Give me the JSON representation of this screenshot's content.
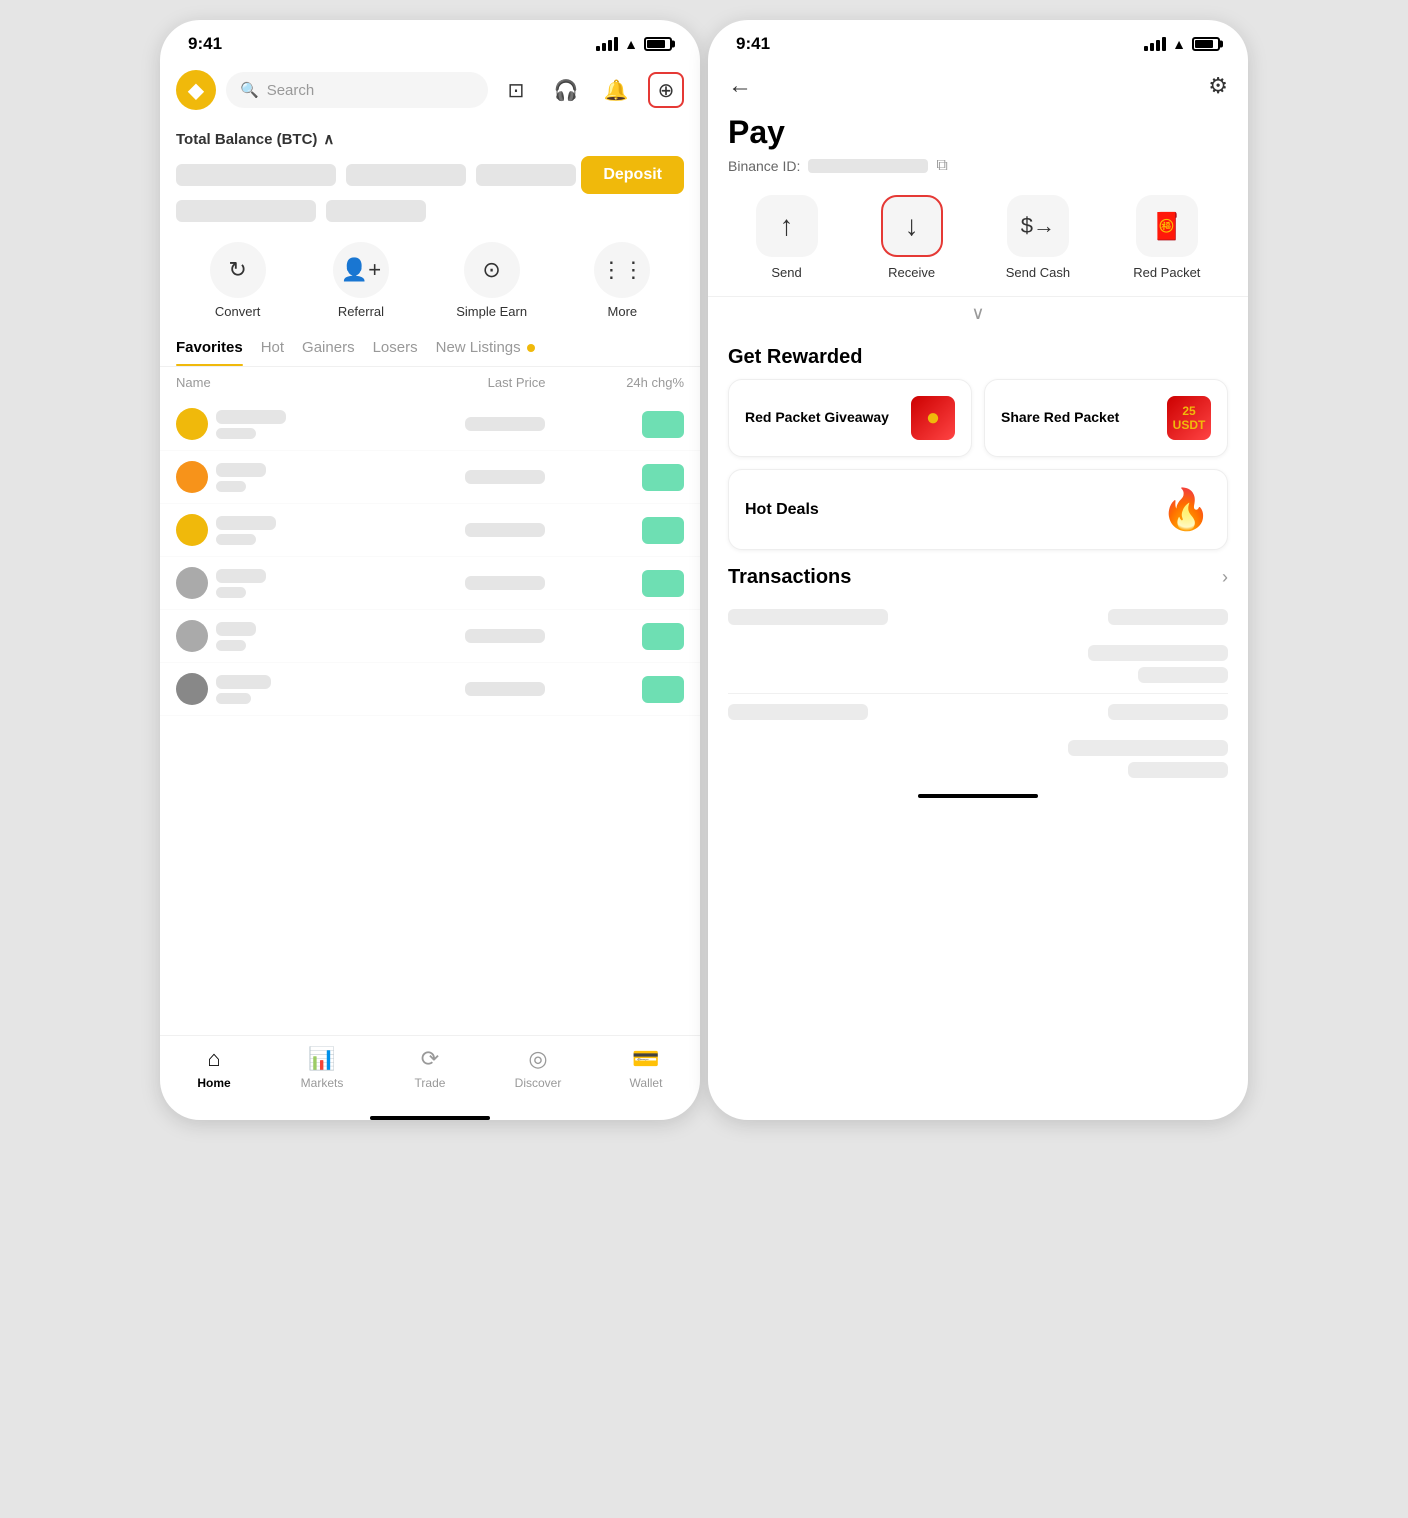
{
  "left_phone": {
    "status": {
      "time": "9:41"
    },
    "header": {
      "search_placeholder": "Search"
    },
    "balance": {
      "title": "Total Balance (BTC)",
      "deposit_label": "Deposit"
    },
    "quick_actions": [
      {
        "id": "convert",
        "label": "Convert",
        "icon": "↻"
      },
      {
        "id": "referral",
        "label": "Referral",
        "icon": "👤"
      },
      {
        "id": "simple-earn",
        "label": "Simple Earn",
        "icon": "⊙"
      },
      {
        "id": "more",
        "label": "More",
        "icon": "⋮⋮"
      }
    ],
    "tabs": [
      {
        "id": "favorites",
        "label": "Favorites",
        "active": true
      },
      {
        "id": "hot",
        "label": "Hot",
        "active": false
      },
      {
        "id": "gainers",
        "label": "Gainers",
        "active": false
      },
      {
        "id": "losers",
        "label": "Losers",
        "active": false
      },
      {
        "id": "new-listings",
        "label": "New Listings",
        "active": false
      }
    ],
    "table": {
      "columns": {
        "name": "Name",
        "price": "Last Price",
        "change": "24h chg%"
      },
      "rows": [
        {
          "id": 1,
          "color": "#F0B90B"
        },
        {
          "id": 2,
          "color": "#F7931A"
        },
        {
          "id": 3,
          "color": "#F0B90B"
        },
        {
          "id": 4,
          "color": "#888"
        },
        {
          "id": 5,
          "color": "#888"
        },
        {
          "id": 6,
          "color": "#888"
        }
      ]
    },
    "bottom_nav": [
      {
        "id": "home",
        "label": "Home",
        "icon": "🏠",
        "active": true
      },
      {
        "id": "markets",
        "label": "Markets",
        "icon": "📊",
        "active": false
      },
      {
        "id": "trade",
        "label": "Trade",
        "icon": "🔄",
        "active": false
      },
      {
        "id": "discover",
        "label": "Discover",
        "icon": "🔍",
        "active": false
      },
      {
        "id": "wallet",
        "label": "Wallet",
        "icon": "💳",
        "active": false
      }
    ]
  },
  "right_phone": {
    "status": {
      "time": "9:41"
    },
    "page_title": "Pay",
    "binance_id_label": "Binance ID:",
    "actions": [
      {
        "id": "send",
        "label": "Send",
        "icon": "↑"
      },
      {
        "id": "receive",
        "label": "Receive",
        "icon": "↓",
        "highlighted": true
      },
      {
        "id": "send-cash",
        "label": "Send Cash",
        "icon": "$"
      },
      {
        "id": "red-packet",
        "label": "Red Packet",
        "icon": "🧧"
      }
    ],
    "sections": {
      "get_rewarded": {
        "title": "Get Rewarded",
        "cards": [
          {
            "id": "red-packet-giveaway",
            "title": "Red Packet Giveaway"
          },
          {
            "id": "share-red-packet",
            "title": "Share Red Packet"
          }
        ],
        "hot_deals": {
          "id": "hot-deals",
          "title": "Hot Deals"
        }
      },
      "transactions": {
        "title": "Transactions"
      }
    }
  }
}
